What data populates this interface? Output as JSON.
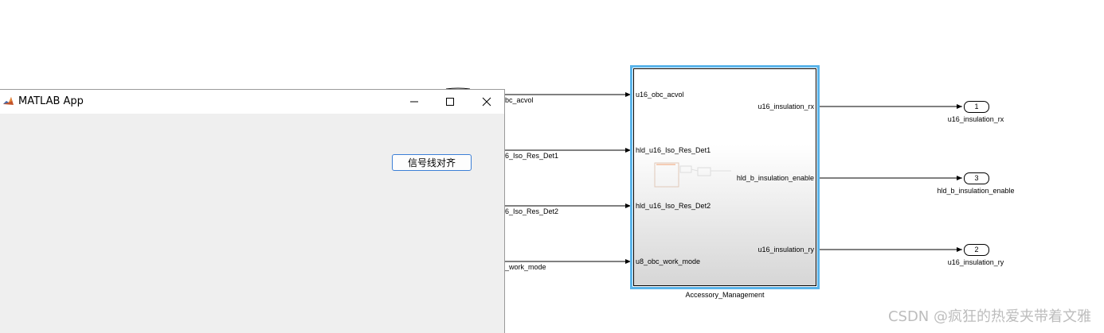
{
  "model": {
    "subsystem": {
      "name": "Accessory_Management",
      "inports": [
        "u16_obc_acvol",
        "hld_u16_Iso_Res_Det1",
        "hld_u16_Iso_Res_Det2",
        "u8_obc_work_mode"
      ],
      "outports": [
        "u16_insulation_rx",
        "hld_b_insulation_enable",
        "u16_insulation_ry"
      ]
    },
    "input_signals": [
      "bc_acvol",
      "6_Iso_Res_Det1",
      "6_Iso_Res_Det2",
      "_work_mode"
    ],
    "outport_blocks": [
      {
        "number": "1",
        "name": "u16_insulation_rx"
      },
      {
        "number": "3",
        "name": "hld_b_insulation_enable"
      },
      {
        "number": "2",
        "name": "u16_insulation_ry"
      }
    ],
    "line_color": "#000000",
    "selection_color": "#5ab4ea"
  },
  "app_window": {
    "title": "MATLAB App",
    "button_label": "信号线对齐",
    "minimize_icon": "minimize-icon",
    "maximize_icon": "maximize-icon",
    "close_icon": "close-icon"
  },
  "watermark": "CSDN @疯狂的热爱夹带着文雅"
}
